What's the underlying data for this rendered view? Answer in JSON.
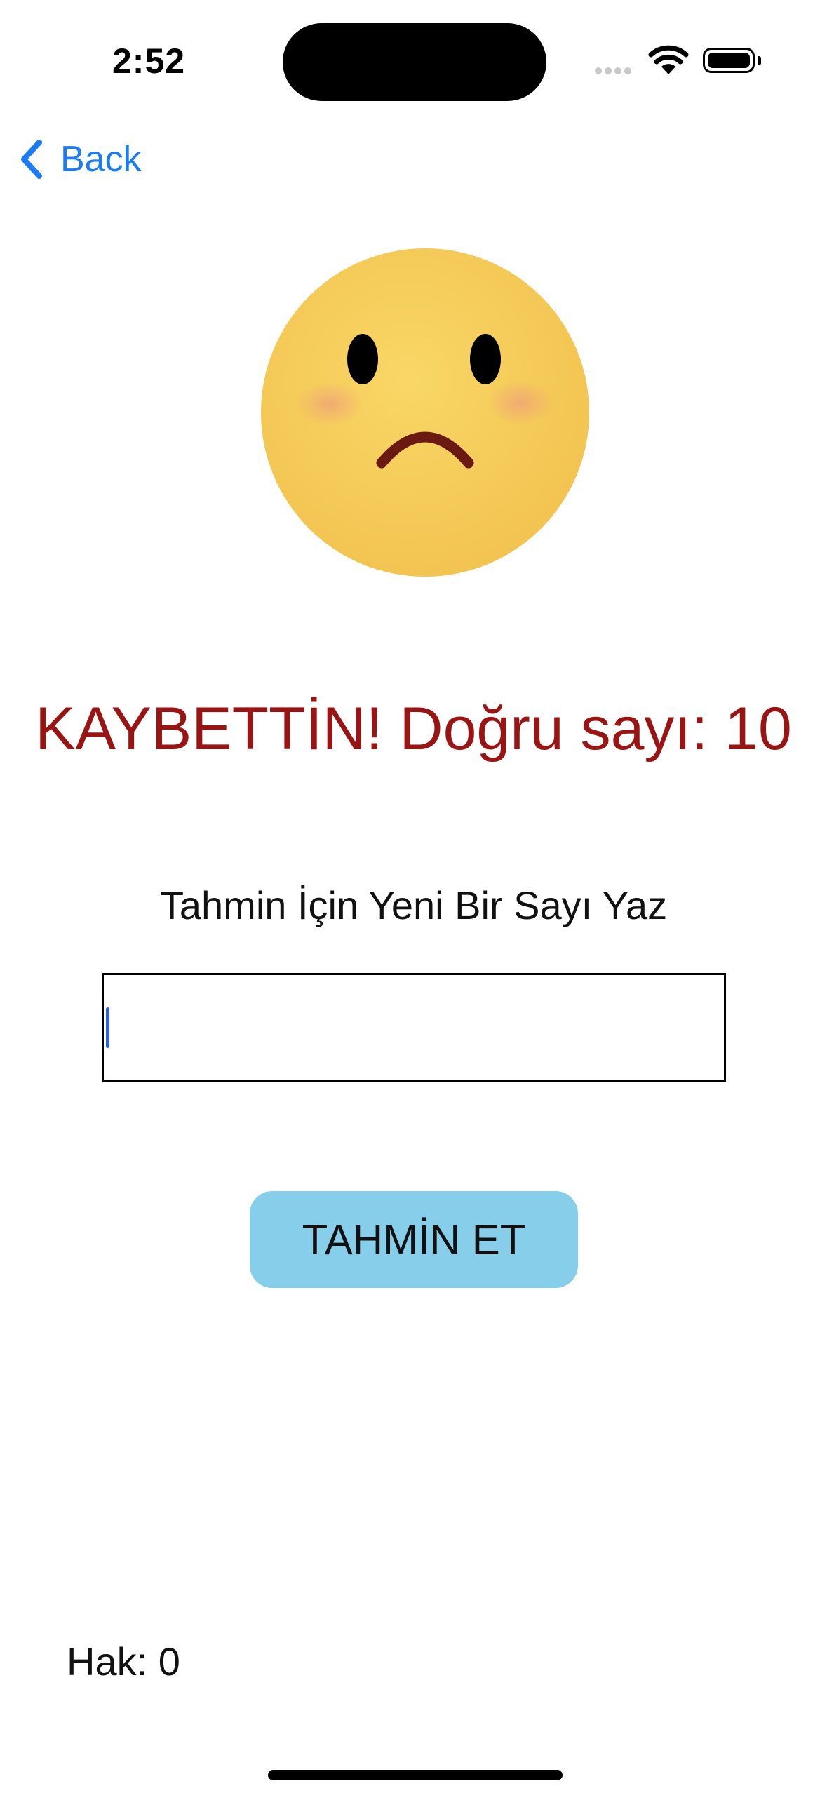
{
  "status_bar": {
    "time": "2:52",
    "icons": [
      "signal-dots-icon",
      "wifi-icon",
      "battery-icon"
    ]
  },
  "nav": {
    "back_label": "Back",
    "back_icon": "chevron-left-icon",
    "accent_color": "#1a7cf5"
  },
  "illustration": {
    "icon": "sad-face-icon",
    "face_color": "#f6cb58",
    "mouth_color": "#6b1a12"
  },
  "result": {
    "text": "KAYBETTİN! Doğru sayı: 10",
    "color": "#9a1414"
  },
  "prompt": {
    "text": "Tahmin İçin Yeni Bir Sayı Yaz"
  },
  "guess_field": {
    "value": "",
    "placeholder": ""
  },
  "guess_button": {
    "label": "TAHMİN ET",
    "color": "#87ceeb"
  },
  "tries": {
    "text": "Hak: 0"
  }
}
